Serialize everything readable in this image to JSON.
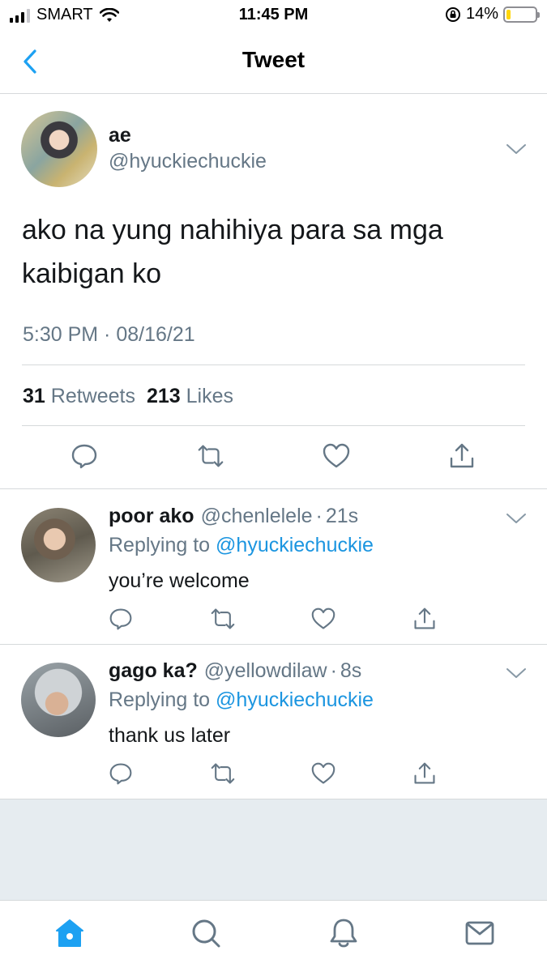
{
  "status_bar": {
    "carrier": "SMART",
    "time": "11:45 PM",
    "battery": "14%",
    "battery_level": 0.14,
    "icons": [
      "signal-icon",
      "wifi-icon",
      "orientation-lock-icon",
      "battery-icon"
    ]
  },
  "nav": {
    "title": "Tweet",
    "back_icon": "chevron-left-icon"
  },
  "main_tweet": {
    "name": "ae",
    "handle": "@hyuckiechuckie",
    "text": "ako na yung nahihiya para sa mga kaibigan ko",
    "timestamp": "5:30 PM · 08/16/21",
    "retweets_count": "31",
    "retweets_label": "Retweets",
    "likes_count": "213",
    "likes_label": "Likes",
    "actions": [
      "reply-icon",
      "retweet-icon",
      "like-icon",
      "share-icon"
    ]
  },
  "replies": [
    {
      "name": "poor ako",
      "handle": "@chenlelele",
      "separator": "·",
      "age": "21s",
      "replying_prefix": "Replying to",
      "replying_to": "@hyuckiechuckie",
      "text": "you’re welcome"
    },
    {
      "name": "gago ka?",
      "handle": "@yellowdilaw",
      "separator": "·",
      "age": "8s",
      "replying_prefix": "Replying to",
      "replying_to": "@hyuckiechuckie",
      "text": "thank us later"
    }
  ],
  "tab_bar": {
    "items": [
      "home-icon",
      "search-icon",
      "notifications-icon",
      "messages-icon"
    ],
    "active": "home-icon"
  },
  "colors": {
    "accent": "#1da1f2",
    "mention": "#1b95e0",
    "secondary_text": "#657786",
    "primary_text": "#14171a",
    "divider": "#d6d9db",
    "footer_bg": "#e6ecf0"
  }
}
